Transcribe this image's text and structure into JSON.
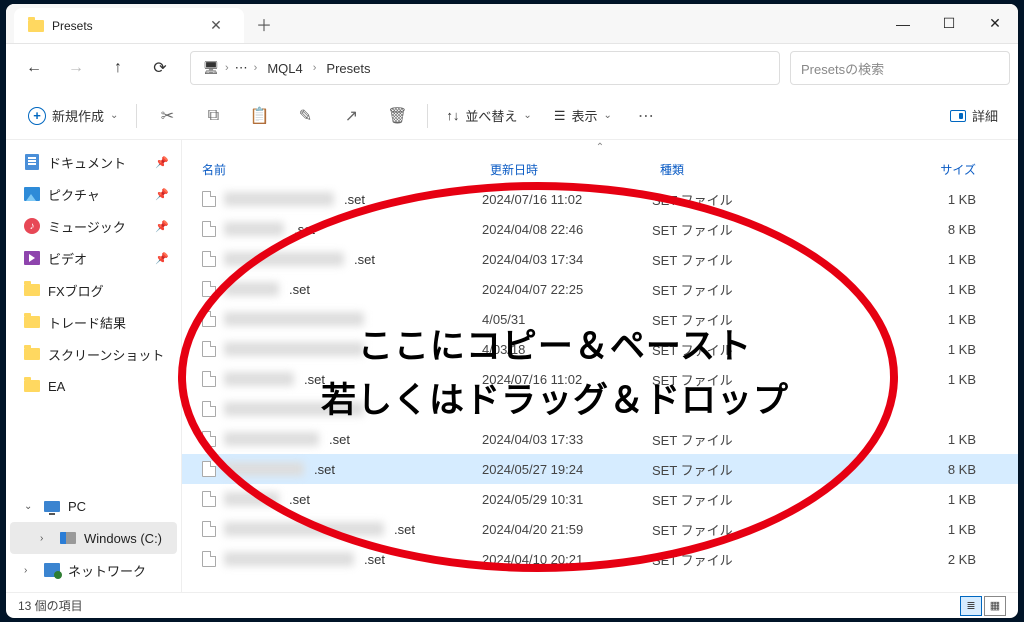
{
  "window": {
    "tab_title": "Presets"
  },
  "breadcrumb": {
    "item1": "MQL4",
    "item2": "Presets"
  },
  "search": {
    "placeholder": "Presetsの検索"
  },
  "toolbar": {
    "new_label": "新規作成",
    "sort_label": "並べ替え",
    "view_label": "表示",
    "details_label": "詳細"
  },
  "sidebar": {
    "quick": [
      {
        "label": "ドキュメント",
        "pinned": true,
        "icon": "doc"
      },
      {
        "label": "ピクチャ",
        "pinned": true,
        "icon": "pic"
      },
      {
        "label": "ミュージック",
        "pinned": true,
        "icon": "music"
      },
      {
        "label": "ビデオ",
        "pinned": true,
        "icon": "video"
      },
      {
        "label": "FXブログ",
        "pinned": false,
        "icon": "folder"
      },
      {
        "label": "トレード結果",
        "pinned": false,
        "icon": "folder"
      },
      {
        "label": "スクリーンショット",
        "pinned": false,
        "icon": "folder"
      },
      {
        "label": "EA",
        "pinned": false,
        "icon": "folder"
      }
    ],
    "pc_label": "PC",
    "drive_label": "Windows (C:)",
    "network_label": "ネットワーク"
  },
  "columns": {
    "name": "名前",
    "date": "更新日時",
    "type": "種類",
    "size": "サイズ"
  },
  "files": [
    {
      "ext": ".set",
      "date": "2024/07/16 11:02",
      "type": "SET ファイル",
      "size": "1 KB",
      "bw": 110,
      "selected": false
    },
    {
      "ext": ".set",
      "date": "2024/04/08 22:46",
      "type": "SET ファイル",
      "size": "8 KB",
      "bw": 60,
      "selected": false
    },
    {
      "ext": ".set",
      "date": "2024/04/03 17:34",
      "type": "SET ファイル",
      "size": "1 KB",
      "bw": 120,
      "selected": false
    },
    {
      "ext": ".set",
      "date": "2024/04/07 22:25",
      "type": "SET ファイル",
      "size": "1 KB",
      "bw": 55,
      "selected": false
    },
    {
      "ext": "",
      "date": "4/05/31",
      "type": "SET ファイル",
      "size": "1 KB",
      "bw": 140,
      "selected": false
    },
    {
      "ext": "",
      "date": "4/03/18",
      "type": "SET ファイル",
      "size": "1 KB",
      "bw": 140,
      "selected": false
    },
    {
      "ext": ".set",
      "date": "2024/07/16 11:02",
      "type": "SET ファイル",
      "size": "1 KB",
      "bw": 70,
      "selected": false
    },
    {
      "ext": "",
      "date": "",
      "type": "",
      "size": "",
      "bw": 140,
      "selected": false
    },
    {
      "ext": ".set",
      "date": "2024/04/03 17:33",
      "type": "SET ファイル",
      "size": "1 KB",
      "bw": 95,
      "selected": false
    },
    {
      "ext": ".set",
      "date": "2024/05/27 19:24",
      "type": "SET ファイル",
      "size": "8 KB",
      "bw": 80,
      "selected": true
    },
    {
      "ext": ".set",
      "date": "2024/05/29 10:31",
      "type": "SET ファイル",
      "size": "1 KB",
      "bw": 55,
      "selected": false
    },
    {
      "ext": ".set",
      "date": "2024/04/20 21:59",
      "type": "SET ファイル",
      "size": "1 KB",
      "bw": 160,
      "selected": false
    },
    {
      "ext": ".set",
      "date": "2024/04/10 20:21",
      "type": "SET ファイル",
      "size": "2 KB",
      "bw": 130,
      "selected": false
    }
  ],
  "status": {
    "count_label": "13 個の項目"
  },
  "annotation": {
    "line1": "ここにコピー＆ペースト",
    "line2": "若しくはドラッグ＆ドロップ"
  }
}
